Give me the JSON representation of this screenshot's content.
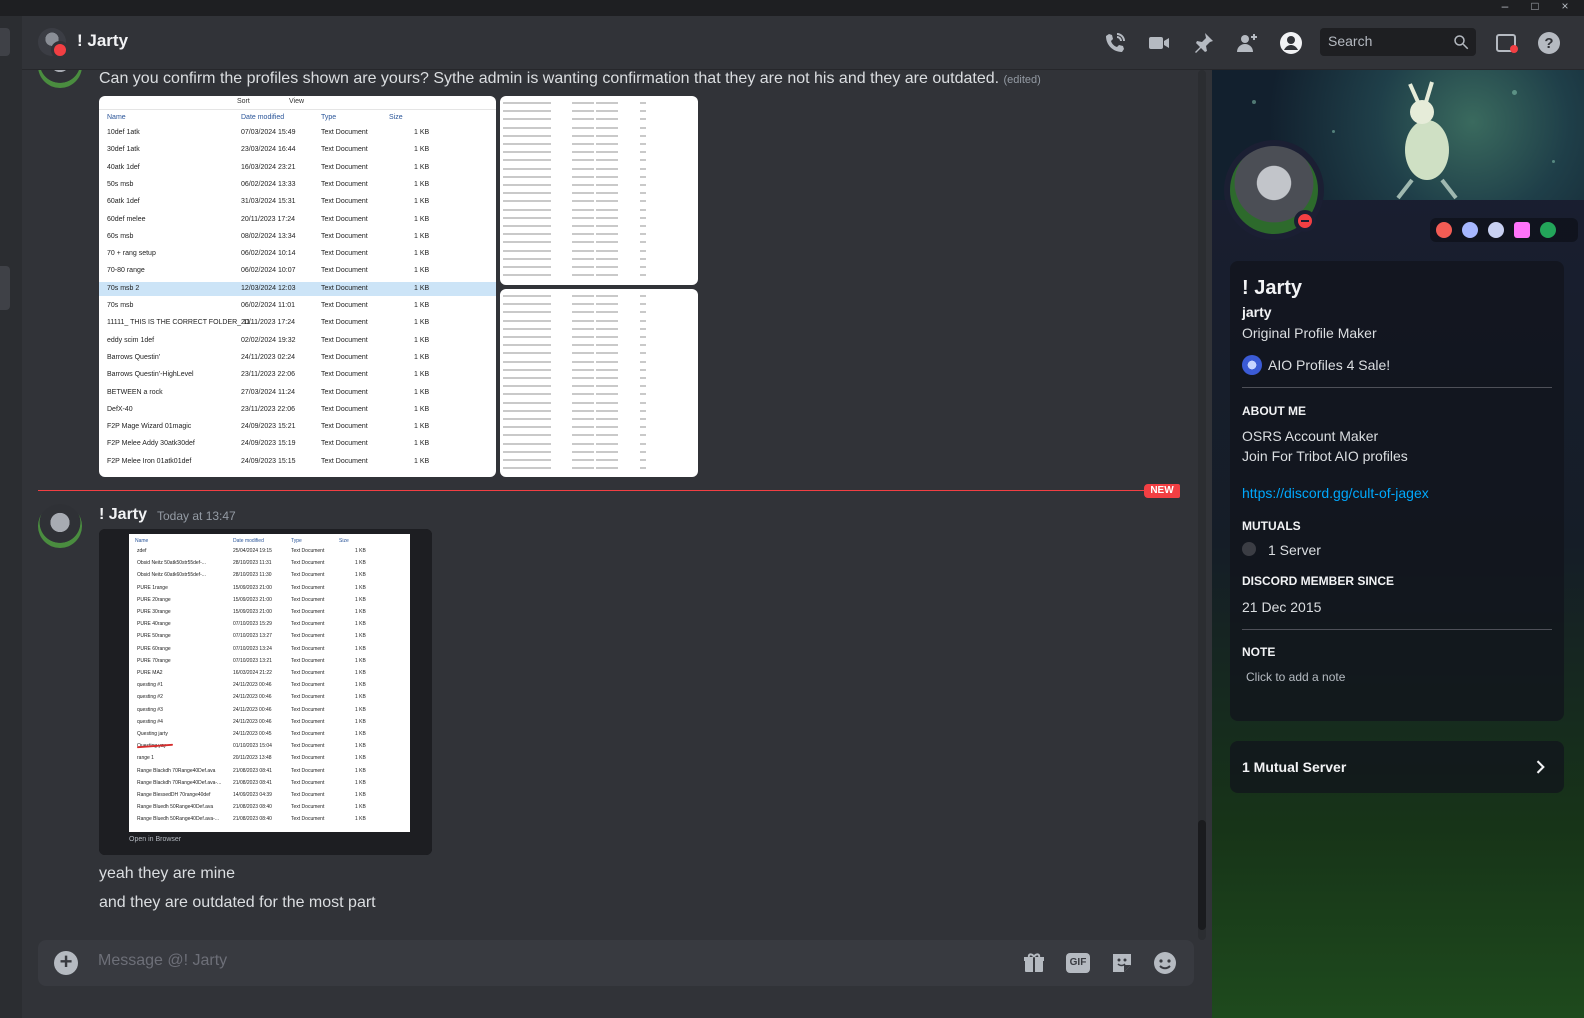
{
  "header": {
    "name": "! Jarty",
    "search_placeholder": "Search",
    "icons": [
      "phone-call-icon",
      "video-call-icon",
      "pin-icon",
      "add-friends-icon",
      "user-profile-icon",
      "inbox-icon",
      "help-icon"
    ]
  },
  "messages": [
    {
      "text": "Can you confirm the profiles shown are yours? Sythe admin is wanting confirmation that they are not his and they are outdated.",
      "edited": "(edited)",
      "attachments": {
        "explorer": {
          "toolbar": [
            "Sort",
            "View"
          ],
          "columns": [
            "Name",
            "Date modified",
            "Type",
            "Size"
          ],
          "rows": [
            {
              "name": "10def 1atk",
              "date": "07/03/2024 15:49",
              "type": "Text Document",
              "size": "1 KB"
            },
            {
              "name": "30def 1atk",
              "date": "23/03/2024 16:44",
              "type": "Text Document",
              "size": "1 KB"
            },
            {
              "name": "40atk 1def",
              "date": "16/03/2024 23:21",
              "type": "Text Document",
              "size": "1 KB"
            },
            {
              "name": "50s msb",
              "date": "06/02/2024 13:33",
              "type": "Text Document",
              "size": "1 KB"
            },
            {
              "name": "60atk 1def",
              "date": "31/03/2024 15:31",
              "type": "Text Document",
              "size": "1 KB"
            },
            {
              "name": "60def melee",
              "date": "20/11/2023 17:24",
              "type": "Text Document",
              "size": "1 KB"
            },
            {
              "name": "60s msb",
              "date": "08/02/2024 13:34",
              "type": "Text Document",
              "size": "1 KB"
            },
            {
              "name": "70 + rang setup",
              "date": "06/02/2024 10:14",
              "type": "Text Document",
              "size": "1 KB"
            },
            {
              "name": "70-80 range",
              "date": "06/02/2024 10:07",
              "type": "Text Document",
              "size": "1 KB"
            },
            {
              "name": "70s msb 2",
              "date": "12/03/2024 12:03",
              "type": "Text Document",
              "size": "1 KB"
            },
            {
              "name": "70s msb",
              "date": "06/02/2024 11:01",
              "type": "Text Document",
              "size": "1 KB"
            },
            {
              "name": "11111_ THIS IS THE CORRECT FOLDER_ 11...",
              "date": "20/11/2023 17:24",
              "type": "Text Document",
              "size": "1 KB"
            },
            {
              "name": "eddy scim 1def",
              "date": "02/02/2024 19:32",
              "type": "Text Document",
              "size": "1 KB"
            },
            {
              "name": "Barrows Questin'",
              "date": "24/11/2023 02:24",
              "type": "Text Document",
              "size": "1 KB"
            },
            {
              "name": "Barrows Questin'-HighLevel",
              "date": "23/11/2023 22:06",
              "type": "Text Document",
              "size": "1 KB"
            },
            {
              "name": "BETWEEN a rock",
              "date": "27/03/2024 11:24",
              "type": "Text Document",
              "size": "1 KB"
            },
            {
              "name": "DefX-40",
              "date": "23/11/2023 22:06",
              "type": "Text Document",
              "size": "1 KB"
            },
            {
              "name": "F2P Mage Wizard 01magic",
              "date": "24/09/2023 15:21",
              "type": "Text Document",
              "size": "1 KB"
            },
            {
              "name": "F2P Melee Addy 30atk30def",
              "date": "24/09/2023 15:19",
              "type": "Text Document",
              "size": "1 KB"
            },
            {
              "name": "F2P Melee Iron 01atk01def",
              "date": "24/09/2023 15:15",
              "type": "Text Document",
              "size": "1 KB"
            }
          ]
        }
      }
    },
    {
      "author": "! Jarty",
      "timestamp": "Today at 13:47",
      "screenshot": {
        "columns": [
          "Name",
          "Date modified",
          "Type",
          "Size"
        ],
        "rows": [
          {
            "name": "zdef",
            "date": "25/04/2024 19:15",
            "type": "Text Document",
            "size": "1 KB"
          },
          {
            "name": "Obsid Neitz 50atk50str55def-...",
            "date": "28/10/2023 11:31",
            "type": "Text Document",
            "size": "1 KB"
          },
          {
            "name": "Obsid Neitz 60atk60str55def-...",
            "date": "28/10/2023 11:30",
            "type": "Text Document",
            "size": "1 KB"
          },
          {
            "name": "PURE 1range",
            "date": "15/09/2023 21:00",
            "type": "Text Document",
            "size": "1 KB"
          },
          {
            "name": "PURE 20range",
            "date": "15/09/2023 21:00",
            "type": "Text Document",
            "size": "1 KB"
          },
          {
            "name": "PURE 30range",
            "date": "15/09/2023 21:00",
            "type": "Text Document",
            "size": "1 KB"
          },
          {
            "name": "PURE 40range",
            "date": "07/10/2023 15:29",
            "type": "Text Document",
            "size": "1 KB"
          },
          {
            "name": "PURE 50range",
            "date": "07/10/2023 13:27",
            "type": "Text Document",
            "size": "1 KB"
          },
          {
            "name": "PURE 60range",
            "date": "07/10/2023 13:24",
            "type": "Text Document",
            "size": "1 KB"
          },
          {
            "name": "PURE 70range",
            "date": "07/10/2023 13:21",
            "type": "Text Document",
            "size": "1 KB"
          },
          {
            "name": "PURE MA2",
            "date": "16/03/2024 21:22",
            "type": "Text Document",
            "size": "1 KB"
          },
          {
            "name": "questing #1",
            "date": "24/11/2023 00:46",
            "type": "Text Document",
            "size": "1 KB"
          },
          {
            "name": "questing #2",
            "date": "24/11/2023 00:46",
            "type": "Text Document",
            "size": "1 KB"
          },
          {
            "name": "questing #3",
            "date": "24/11/2023 00:46",
            "type": "Text Document",
            "size": "1 KB"
          },
          {
            "name": "questing #4",
            "date": "24/11/2023 00:46",
            "type": "Text Document",
            "size": "1 KB"
          },
          {
            "name": "Questing jarty",
            "date": "24/11/2023 00:45",
            "type": "Text Document",
            "size": "1 KB"
          },
          {
            "name": "Questing yay",
            "date": "01/10/2023 15:04",
            "type": "Text Document",
            "size": "1 KB"
          },
          {
            "name": "range 1",
            "date": "20/11/2023 13:48",
            "type": "Text Document",
            "size": "1 KB"
          },
          {
            "name": "Range Blackdh 70Range40Def.ava",
            "date": "21/08/2023 08:41",
            "type": "Text Document",
            "size": "1 KB"
          },
          {
            "name": "Range Blackdh 70Range40Def.ava-...",
            "date": "21/08/2023 08:41",
            "type": "Text Document",
            "size": "1 KB"
          },
          {
            "name": "Range BlessedDH 70range40def",
            "date": "14/09/2023 04:39",
            "type": "Text Document",
            "size": "1 KB"
          },
          {
            "name": "Range Bluedh 50Range40Def.ava",
            "date": "21/08/2023 08:40",
            "type": "Text Document",
            "size": "1 KB"
          },
          {
            "name": "Range Bluedh 50Range40Def.ava-...",
            "date": "21/08/2023 08:40",
            "type": "Text Document",
            "size": "1 KB"
          }
        ],
        "open_in_browser": "Open in Browser"
      },
      "lines": [
        "yeah they are mine",
        "and they are outdated for the most part"
      ]
    }
  ],
  "new_badge": "NEW",
  "composer": {
    "placeholder": "Message @! Jarty",
    "icons": [
      "gift-icon",
      "gif-icon",
      "sticker-icon",
      "emoji-icon"
    ],
    "gif_label": "GIF"
  },
  "profile": {
    "display_name": "! Jarty",
    "username": "jarty",
    "pronouns": "Original Profile Maker",
    "custom_status": "AIO Profiles 4 Sale!",
    "about_title": "ABOUT ME",
    "about_lines": [
      "OSRS Account Maker",
      "Join For Tribot AIO profiles"
    ],
    "about_link": "https://discord.gg/cult-of-jagex",
    "mutuals_title": "MUTUALS",
    "mutual_servers": "1 Server",
    "member_since_title": "DISCORD MEMBER SINCE",
    "member_since": "21 Dec 2015",
    "note_title": "NOTE",
    "note_placeholder": "Click to add a note",
    "mutual_server_button": "1 Mutual Server",
    "badge_colors": [
      "#f25c54",
      "#a6b7ff",
      "#c9d1f2",
      "#ff73fa",
      "#23a55a"
    ]
  }
}
